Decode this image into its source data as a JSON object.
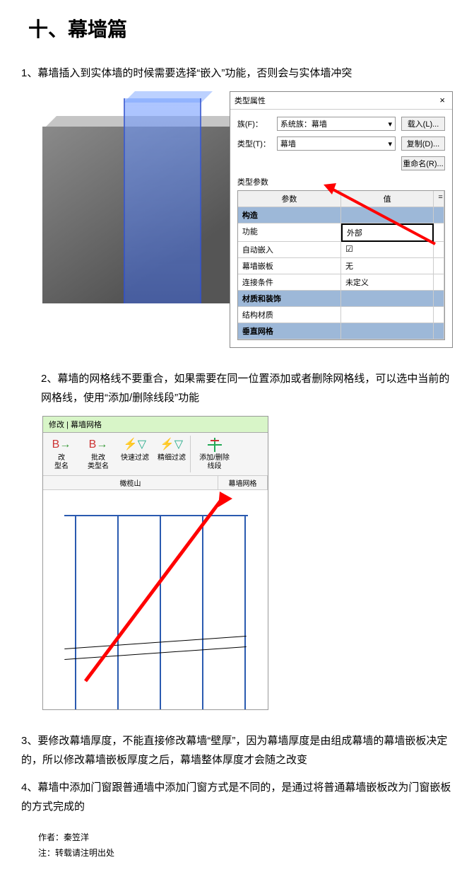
{
  "title": "十、幕墙篇",
  "items": [
    "1、幕墙插入到实体墙的时候需要选择“嵌入”功能，否则会与实体墙冲突",
    "2、幕墙的网格线不要重合，如果需要在同一位置添加或者删除网格线，可以选中当前的网格线，使用“添加/删除线段”功能",
    "3、要修改幕墙厚度，不能直接修改幕墙“壁厚”，因为幕墙厚度是由组成幕墙的幕墙嵌板决定的，所以修改幕墙嵌板厚度之后，幕墙整体厚度才会随之改变",
    "4、幕墙中添加门窗跟普通墙中添加门窗方式是不同的，是通过将普通幕墙嵌板改为门窗嵌板的方式完成的"
  ],
  "dialog": {
    "title": "类型属性",
    "close": "×",
    "family_label": "族(F)：",
    "family_value": "系统族：幕墙",
    "type_label": "类型(T)：",
    "type_value": "幕墙",
    "btn_load": "载入(L)...",
    "btn_dup": "复制(D)...",
    "btn_rename": "重命名(R)...",
    "params_label": "类型参数",
    "col_param": "参数",
    "col_value": "值",
    "rows": {
      "cat1": "构造",
      "r1_p": "功能",
      "r1_v": "外部",
      "r2_p": "自动嵌入",
      "r3_p": "幕墙嵌板",
      "r3_v": "无",
      "r4_p": "连接条件",
      "r4_v": "未定义",
      "cat2": "材质和装饰",
      "r5_p": "结构材质",
      "cat3": "垂直网格"
    }
  },
  "ribbon": {
    "tab": "修改 | 幕墙网格",
    "btns": [
      {
        "label1": "改",
        "label2": "型名",
        "icon": "B→"
      },
      {
        "label1": "批改",
        "label2": "类型名",
        "icon": "B→"
      },
      {
        "label1": "快速过滤",
        "label2": "",
        "icon": "▽"
      },
      {
        "label1": "精细过滤",
        "label2": "",
        "icon": "▽"
      },
      {
        "label1": "添加/删除",
        "label2": "线段",
        "icon": "＃"
      }
    ],
    "group1": "橄榄山",
    "group2": "幕墙网格"
  },
  "chart_data": {
    "type": "table",
    "title": "类型参数",
    "columns": [
      "参数",
      "值"
    ],
    "rows": [
      [
        "构造",
        ""
      ],
      [
        "功能",
        "外部"
      ],
      [
        "自动嵌入",
        "☑"
      ],
      [
        "幕墙嵌板",
        "无"
      ],
      [
        "连接条件",
        "未定义"
      ],
      [
        "材质和装饰",
        ""
      ],
      [
        "结构材质",
        ""
      ],
      [
        "垂直网格",
        ""
      ]
    ]
  },
  "footer": {
    "author_label": "作者：",
    "author": "秦笠洋",
    "note_label": "注：",
    "note": "转载请注明出处"
  }
}
